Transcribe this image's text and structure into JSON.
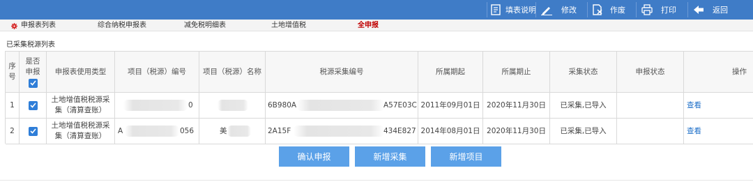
{
  "toolbar": {
    "fill_guide": "填表说明",
    "modify": "修改",
    "void": "作废",
    "print": "打印",
    "back": "返回"
  },
  "tabs": [
    {
      "label": "申报表列表"
    },
    {
      "label": "综合纳税申报表"
    },
    {
      "label": "减免税明细表"
    },
    {
      "label": "土地增值税"
    },
    {
      "label": "全申报"
    }
  ],
  "section_title": "已采集税源列表",
  "table": {
    "headers": {
      "seq": "序号",
      "declare": "是否申报",
      "type": "申报表使用类型",
      "project_no": "项目（税源）编号",
      "project_name": "项目（税源）名称",
      "collect_no": "税源采集编号",
      "start": "所属期起",
      "end": "所属期止",
      "collect_status": "采集状态",
      "declare_status": "申报状态",
      "ops": "操作"
    },
    "rows": [
      {
        "seq": "1",
        "type": "土地增值税税源采集（清算查账）",
        "project_no_tail": "0",
        "collect_head": "6B980A",
        "collect_tail": "A57E03C",
        "start": "2011年09月01日",
        "end": "2020年11月30日",
        "collect_status": "已采集,已导入",
        "declare_status": "",
        "op": "查看"
      },
      {
        "seq": "2",
        "type": "土地增值税税源采集（清算查账）",
        "project_no_head": "A",
        "project_no_tail": "056",
        "project_name_head": "美",
        "collect_head": "2A15F",
        "collect_tail": "434E827",
        "start": "2014年08月01日",
        "end": "2020年11月30日",
        "collect_status": "已采集,已导入",
        "declare_status": "",
        "op": "查看"
      }
    ]
  },
  "buttons": {
    "confirm": "确认申报",
    "add_collect": "新增采集",
    "add_project": "新增项目"
  },
  "colors": {
    "toolbar": "#3f7cc7",
    "button": "#5ba1e8",
    "active_tab": "#c00000",
    "link": "#1e6fc8",
    "checkbox": "#2f7ed8"
  }
}
